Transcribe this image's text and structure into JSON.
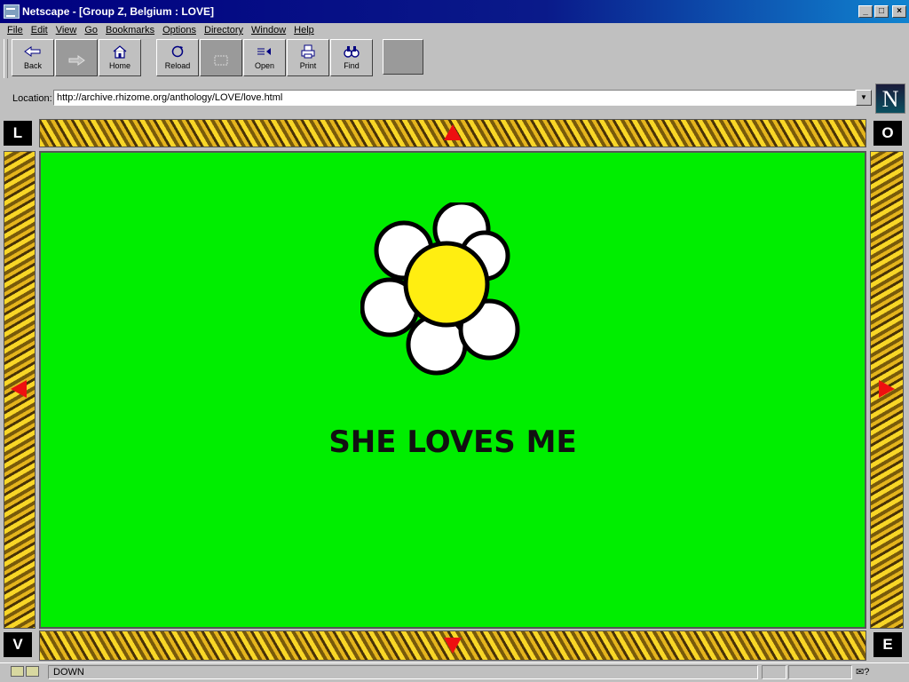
{
  "window": {
    "title": "Netscape - [Group Z, Belgium : LOVE]",
    "controls": [
      "_",
      "□",
      "×"
    ]
  },
  "menu": [
    "File",
    "Edit",
    "View",
    "Go",
    "Bookmarks",
    "Options",
    "Directory",
    "Window",
    "Help"
  ],
  "toolbar": {
    "back": "Back",
    "forward": "",
    "home": "Home",
    "reload": "Reload",
    "images": "",
    "open": "Open",
    "print": "Print",
    "find": "Find"
  },
  "location": {
    "label": "Location:",
    "url": "http://archive.rhizome.org/anthology/LOVE/love.html"
  },
  "logo_letter": "N",
  "page": {
    "corner_letters": [
      "L",
      "O",
      "V",
      "E"
    ],
    "headline": "SHE LOVES ME",
    "background_color": "#00ee00",
    "arrow_color": "#ee1010",
    "flower": {
      "petals": "white",
      "center": "yellow"
    }
  },
  "status": {
    "text": "DOWN"
  }
}
